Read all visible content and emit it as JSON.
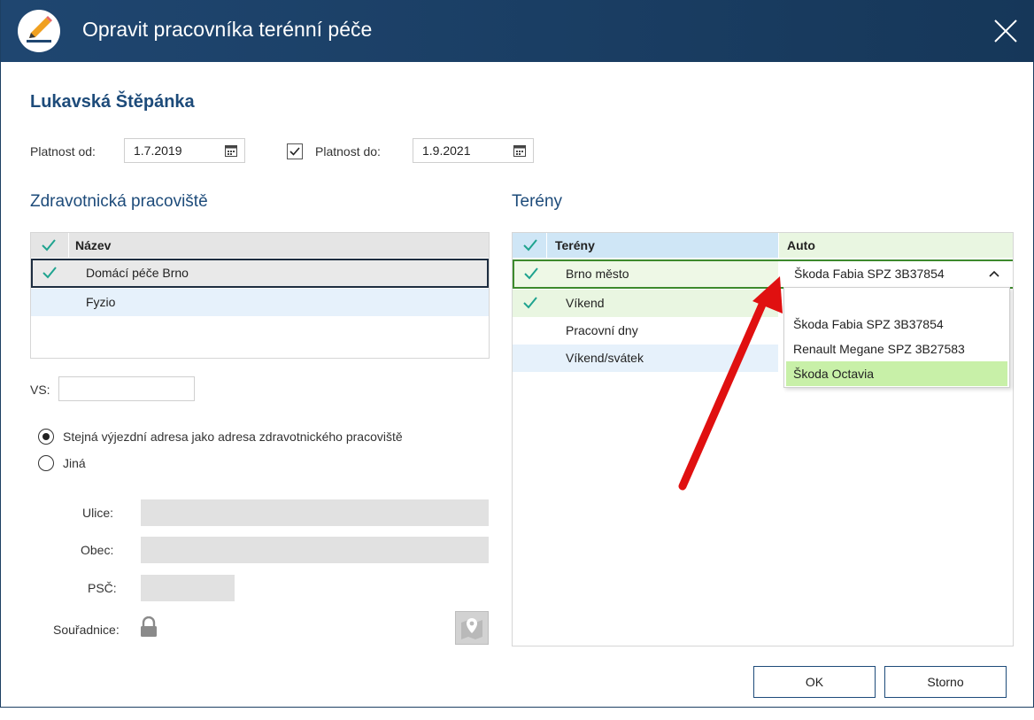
{
  "window": {
    "title": "Opravit pracovníka terénní péče"
  },
  "person_name": "Lukavská Štěpánka",
  "validity": {
    "from_label": "Platnost od:",
    "from_value": "1.7.2019",
    "to_label": "Platnost do:",
    "to_value": "1.9.2021",
    "to_checked": true
  },
  "workplaces": {
    "title": "Zdravotnická pracoviště",
    "column_name": "Název",
    "rows": [
      {
        "name": "Domácí péče Brno",
        "checked": true
      },
      {
        "name": "Fyzio",
        "checked": false
      }
    ]
  },
  "vs_label": "VS:",
  "vs_value": "",
  "address": {
    "option_same": "Stejná výjezdní adresa jako adresa zdravotnického pracoviště",
    "option_other": "Jiná",
    "selected": "same",
    "street_label": "Ulice:",
    "city_label": "Obec:",
    "zip_label": "PSČ:",
    "coords_label": "Souřadnice:"
  },
  "terrains": {
    "title": "Terény",
    "col_terrain": "Terény",
    "col_car": "Auto",
    "rows": [
      {
        "name": "Brno město",
        "checked": true,
        "car": "Škoda Fabia SPZ 3B37854"
      },
      {
        "name": "Víkend",
        "checked": true,
        "car": ""
      },
      {
        "name": "Pracovní dny",
        "checked": false,
        "car": ""
      },
      {
        "name": "Víkend/svátek",
        "checked": false,
        "car": ""
      }
    ]
  },
  "car_dropdown": {
    "options": [
      "Škoda Fabia SPZ 3B37854",
      "Renault Megane SPZ 3B27583",
      "Škoda Octavia"
    ],
    "highlighted": "Škoda Octavia"
  },
  "buttons": {
    "ok": "OK",
    "cancel": "Storno"
  },
  "colors": {
    "titlebar": "#1f4670",
    "heading": "#1d4b7a",
    "check": "#1fa38f",
    "selected_row_border": "#3d8a2d",
    "dropdown_highlight": "#c8f0a8",
    "arrow": "#e01010"
  }
}
